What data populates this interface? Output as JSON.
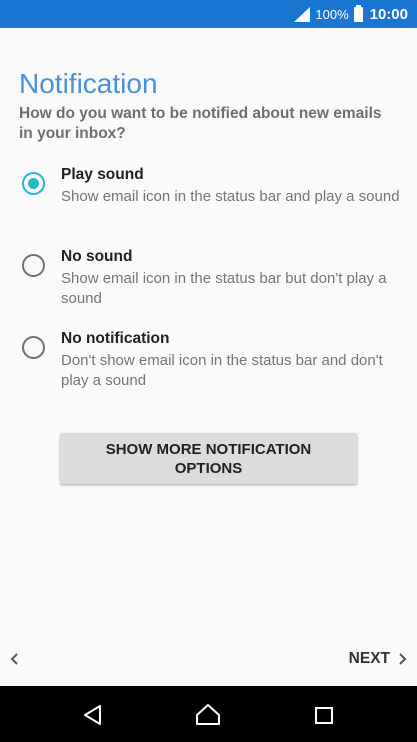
{
  "status_bar": {
    "battery_percent": "100%",
    "time": "10:00",
    "icons": [
      "signal-icon",
      "battery-icon"
    ],
    "bg_color": "#1976d2"
  },
  "page": {
    "title": "Notification",
    "subtitle": "How do you want to be notified about new emails in your inbox?"
  },
  "options": [
    {
      "label": "Play sound",
      "description": "Show email icon in the status bar and play a sound",
      "selected": true
    },
    {
      "label": "No sound",
      "description": "Show email icon in the status bar but don't play a sound",
      "selected": false
    },
    {
      "label": "No notification",
      "description": "Don't show email icon in the status bar and don't play a sound",
      "selected": false
    }
  ],
  "more_button": {
    "label": "SHOW MORE NOTIFICATION OPTIONS"
  },
  "footer": {
    "back_icon": "chevron-left-icon",
    "next_label": "NEXT",
    "next_icon": "chevron-right-icon"
  },
  "nav_bar": {
    "icons": [
      "back-triangle-icon",
      "home-icon",
      "recents-icon"
    ]
  },
  "colors": {
    "title": "#4a90d9",
    "accent": "#26b5c9"
  }
}
